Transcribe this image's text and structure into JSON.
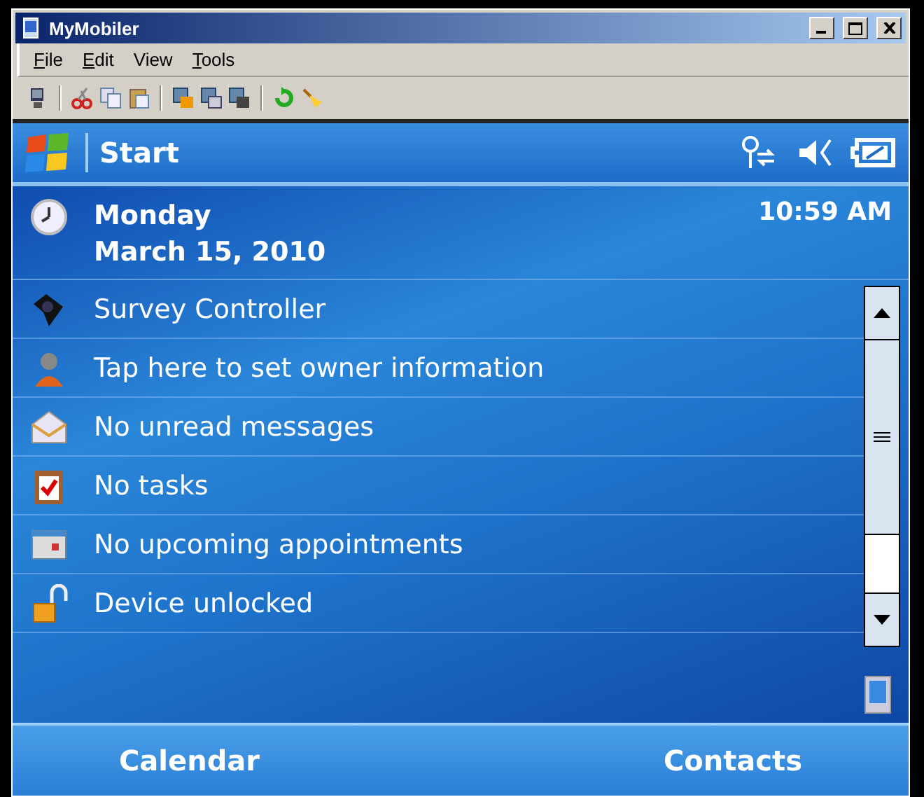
{
  "window": {
    "title": "MyMobiler"
  },
  "menu": [
    {
      "label": "File",
      "underlined_first": true
    },
    {
      "label": "Edit",
      "underlined_first": true
    },
    {
      "label": "View",
      "underlined_first": false
    },
    {
      "label": "Tools",
      "underlined_first": true
    }
  ],
  "toolbar": [
    {
      "kind": "device"
    },
    {
      "kind": "sep"
    },
    {
      "kind": "cut"
    },
    {
      "kind": "copy"
    },
    {
      "kind": "paste"
    },
    {
      "kind": "sep"
    },
    {
      "kind": "window-orange"
    },
    {
      "kind": "window-save"
    },
    {
      "kind": "window-dark"
    },
    {
      "kind": "sep"
    },
    {
      "kind": "refresh"
    },
    {
      "kind": "broom"
    }
  ],
  "device": {
    "start": "Start",
    "day": "Monday",
    "date": "March 15, 2010",
    "time": "10:59 AM",
    "today_items": [
      {
        "kind": "survey",
        "text": "Survey Controller"
      },
      {
        "kind": "owner",
        "text": "Tap here to set owner information"
      },
      {
        "kind": "mail",
        "text": "No unread messages"
      },
      {
        "kind": "tasks",
        "text": "No tasks"
      },
      {
        "kind": "calendar",
        "text": "No upcoming appointments"
      },
      {
        "kind": "lock",
        "text": "Device unlocked"
      }
    ],
    "softkeys": [
      "Calendar",
      "Contacts"
    ]
  }
}
